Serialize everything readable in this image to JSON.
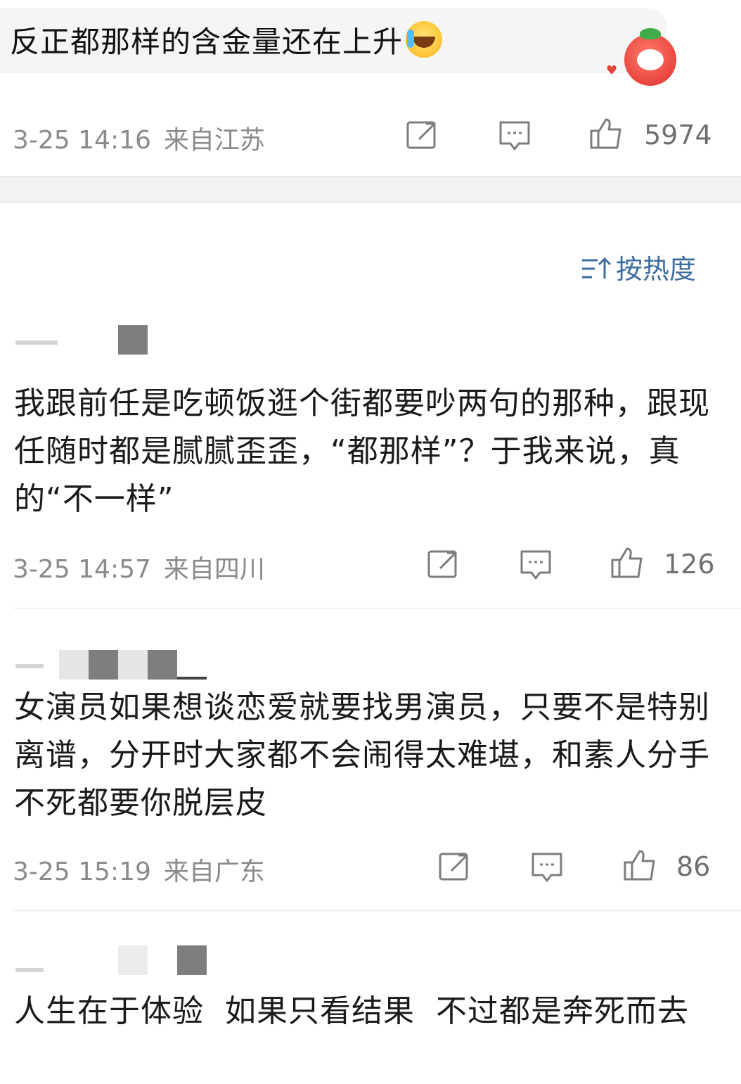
{
  "top_post": {
    "text": "反正都那样的含金量还在上升",
    "emoji": "laughing-crying-emoji",
    "timestamp": "3-25 14:16",
    "location": "来自江苏",
    "likes": "5974"
  },
  "sort": {
    "label": "按热度",
    "icon": "sort-icon"
  },
  "comments": [
    {
      "text": "我跟前任是吃顿饭逛个街都要吵两句的那种，跟现任随时都是腻腻歪歪，“都那样”？于我来说，真的“不一样”",
      "timestamp": "3-25 14:57",
      "location": "来自四川",
      "likes": "126"
    },
    {
      "text": "女演员如果想谈恋爱就要找男演员，只要不是特别离谱，分开时大家都不会闹得太难堪，和素人分手不死都要你脱层皮",
      "timestamp": "3-25 15:19",
      "location": "来自广东",
      "likes": "86"
    },
    {
      "text": "人生在于体验  如果只看结果  不过都是奔死而去"
    }
  ],
  "colors": {
    "accent": "#3d6d9e",
    "meta": "#8a8a8a",
    "band": "#f2f2f2"
  }
}
